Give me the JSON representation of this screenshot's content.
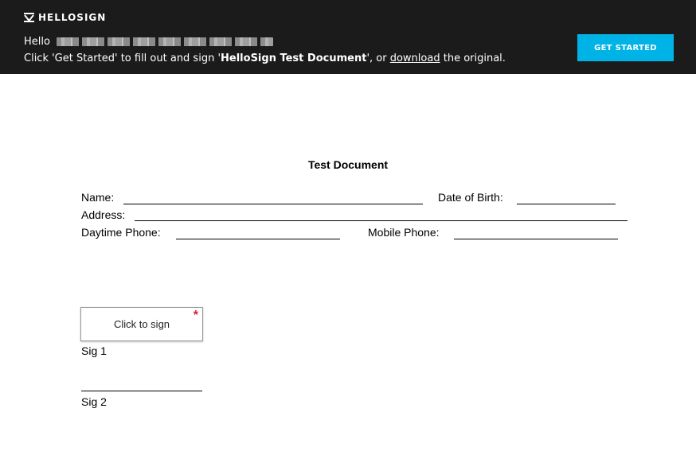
{
  "banner": {
    "logo_text": "HELLOSIGN",
    "greeting": "Hello",
    "instr_prefix": "Click 'Get Started' to fill out and sign '",
    "document_name": "HelloSign Test Document",
    "instr_middle": "', or ",
    "download_link": "download",
    "instr_suffix": " the original.",
    "get_started_label": "GET STARTED",
    "accent_color": "#00b3e6",
    "background_color": "#1b1b1b"
  },
  "document": {
    "title": "Test Document",
    "name_label": "Name:",
    "dob_label": "Date of Birth:",
    "address_label": "Address:",
    "daytime_phone_label": "Daytime Phone:",
    "mobile_phone_label": "Mobile Phone:",
    "sign_button_label": "Click to sign",
    "required_marker": "*",
    "sig1_label": "Sig 1",
    "sig2_label": "Sig 2"
  }
}
